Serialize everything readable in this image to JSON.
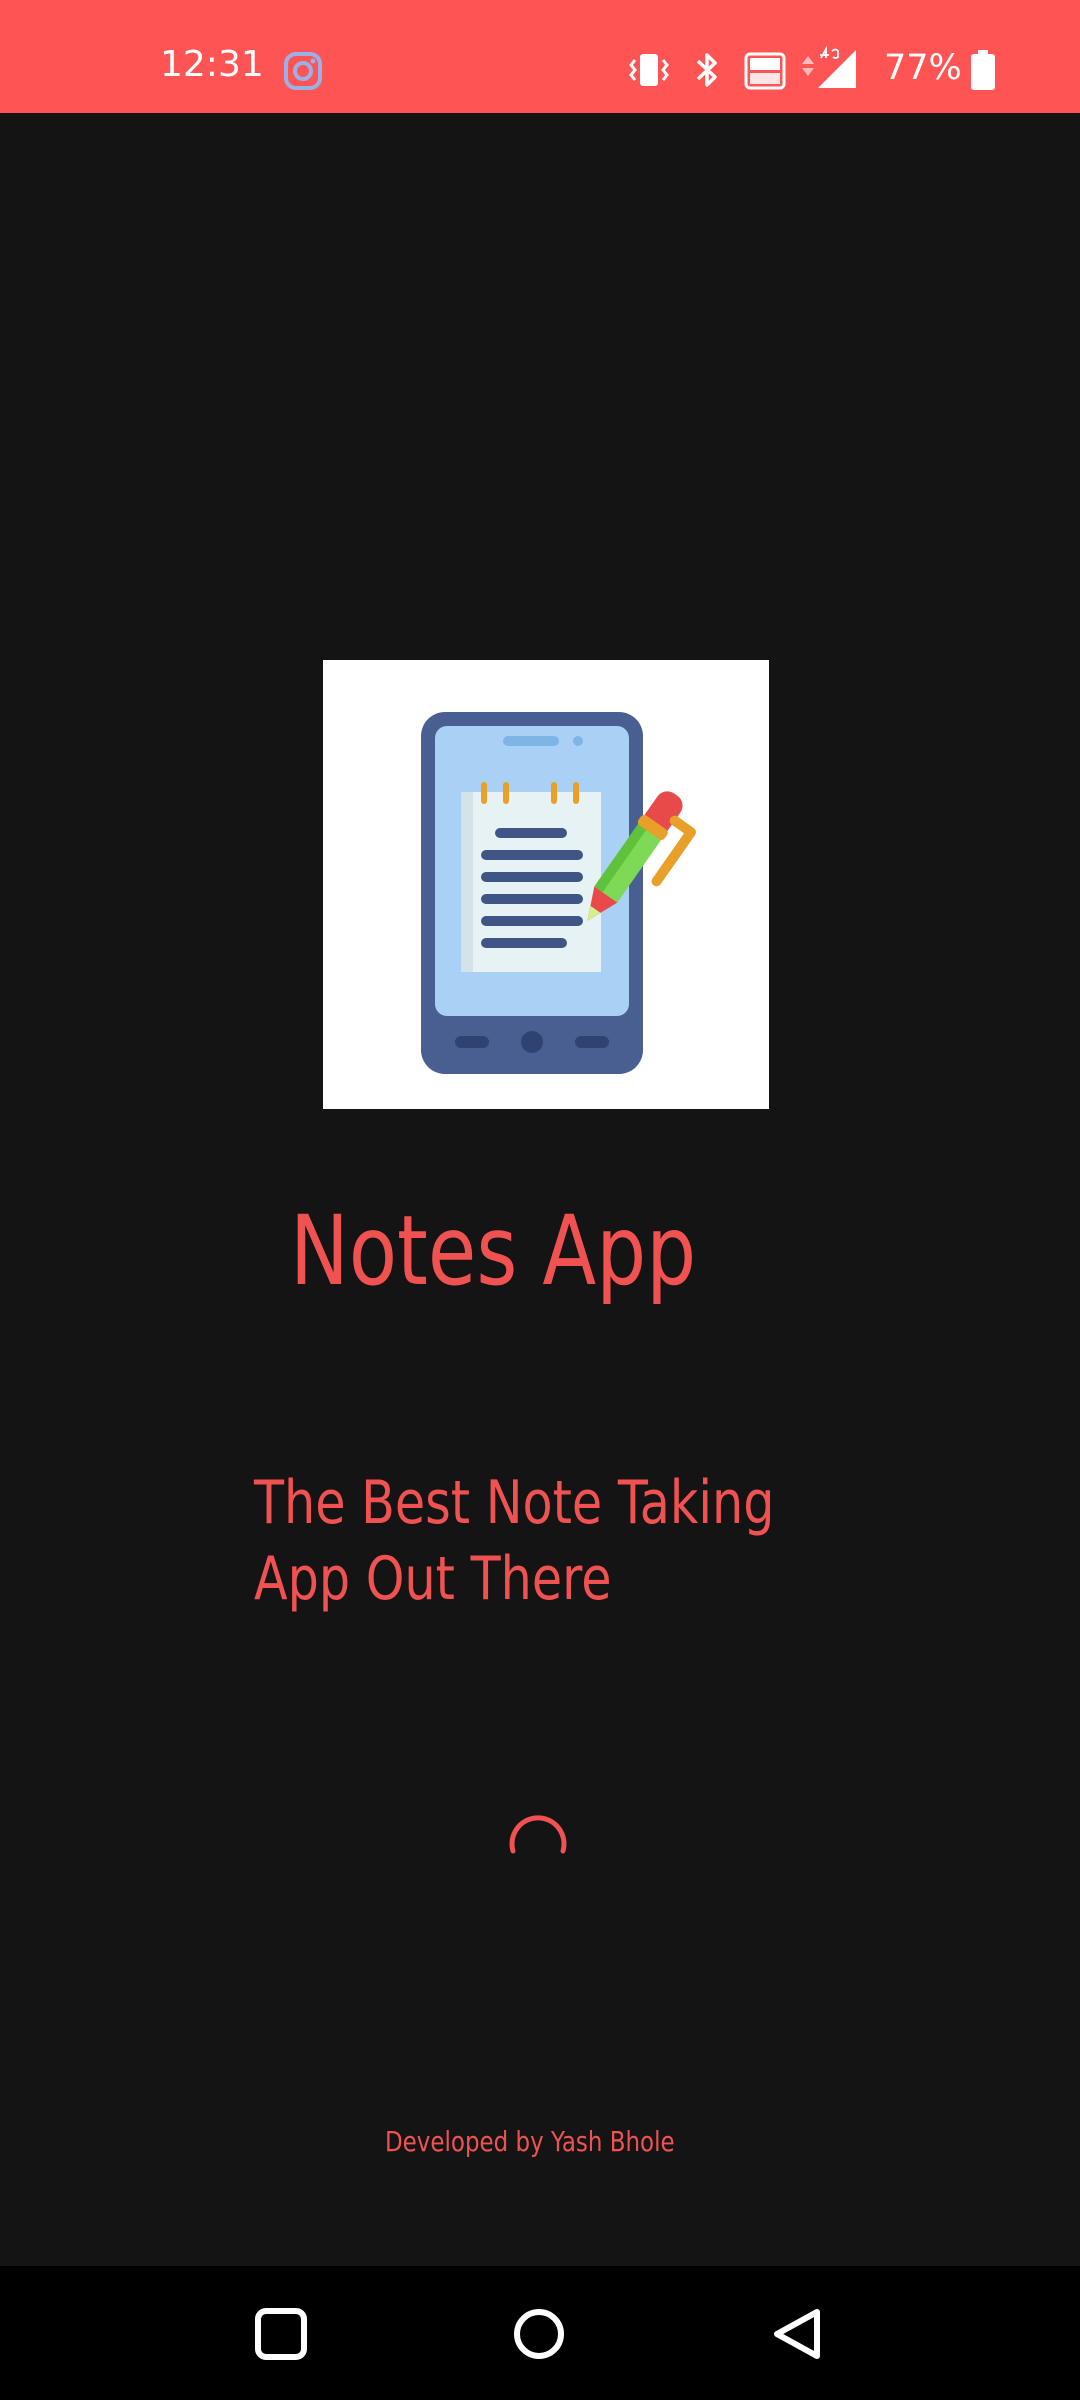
{
  "status_bar": {
    "time": "12:31",
    "battery": "77%",
    "background_color": "#ff5454",
    "icons": [
      "instagram-icon",
      "vibrate-icon",
      "bluetooth-icon",
      "volte-icon",
      "signal-4g-icon",
      "battery-icon"
    ]
  },
  "splash": {
    "logo_icon": "notes-phone-pen-icon",
    "title": "Notes App",
    "tagline": "The Best Note Taking App Out There",
    "credit": "Developed by Yash Bhole",
    "accent_color": "#f05252",
    "background_color": "#141414"
  },
  "nav_bar": {
    "icons": [
      "recents-icon",
      "home-icon",
      "back-icon"
    ]
  }
}
